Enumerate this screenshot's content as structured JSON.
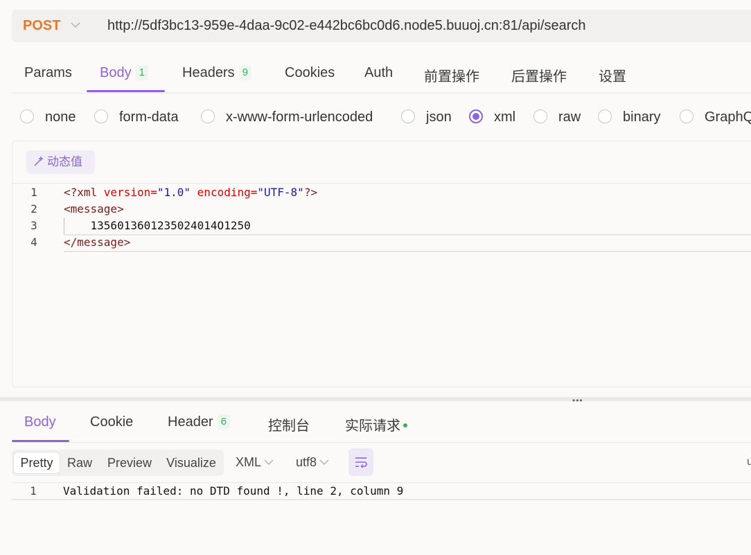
{
  "request": {
    "method": "POST",
    "url": "http://5df3bc13-959e-4daa-9c02-e442bc6bc0d6.node5.buuoj.cn:81/api/search"
  },
  "request_tabs": [
    {
      "label": "Params"
    },
    {
      "label": "Body",
      "count": "1",
      "active": true
    },
    {
      "label": "Headers",
      "count": "9"
    },
    {
      "label": "Cookies"
    },
    {
      "label": "Auth"
    },
    {
      "label": "前置操作"
    },
    {
      "label": "后置操作"
    },
    {
      "label": "设置"
    }
  ],
  "body_types": [
    {
      "label": "none"
    },
    {
      "label": "form-data"
    },
    {
      "label": "x-www-form-urlencoded"
    },
    {
      "label": "json"
    },
    {
      "label": "xml",
      "checked": true
    },
    {
      "label": "raw"
    },
    {
      "label": "binary"
    },
    {
      "label": "GraphQ"
    }
  ],
  "editor": {
    "dynamic_value_label": "动态值",
    "lines": [
      {
        "number": "1",
        "tokens": {
          "p1": "<?xml ",
          "a1": "version=",
          "s1": "\"1.0\"",
          "sp": " ",
          "a2": "encoding=",
          "s2": "\"UTF-8\"",
          "p2": "?>"
        }
      },
      {
        "number": "2",
        "text": "<message>"
      },
      {
        "number": "3",
        "text": "    1356013601235024014O1250"
      },
      {
        "number": "4",
        "text": "</message>"
      }
    ]
  },
  "response_tabs": [
    {
      "label": "Body",
      "active": true
    },
    {
      "label": "Cookie"
    },
    {
      "label": "Header",
      "count": "6"
    },
    {
      "label": "控制台"
    },
    {
      "label": "实际请求",
      "status_dot": true
    }
  ],
  "response_view": {
    "modes": [
      "Pretty",
      "Raw",
      "Preview",
      "Visualize"
    ],
    "active_mode": "Pretty",
    "format": "XML",
    "encoding": "utf8",
    "right_partial": "u"
  },
  "response_body": {
    "lines": [
      {
        "number": "1",
        "text": "Validation failed: no DTD found !, line 2, column 9"
      }
    ]
  },
  "colors": {
    "accent": "#8e63d9",
    "method": "#e8782b",
    "count_badge": "#3fae5a"
  }
}
